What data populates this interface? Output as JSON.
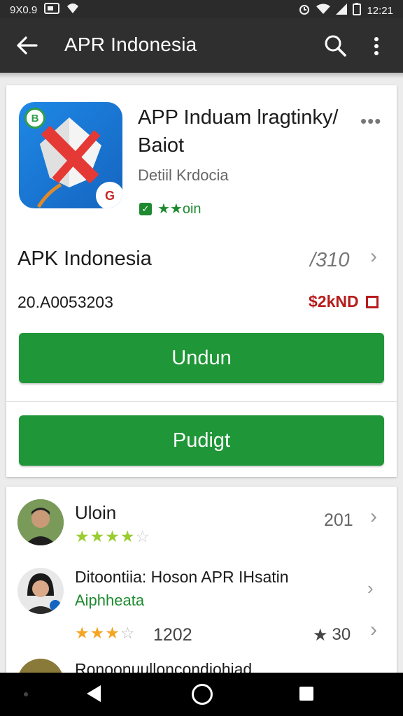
{
  "status_bar": {
    "time_left": "9X0.9",
    "time_right": "12:21"
  },
  "app_bar": {
    "title": "APR Indonesia"
  },
  "app_card": {
    "title": "APP Induam lragtinky/ Baiot",
    "developer": "Detiil Krdocia",
    "rating_label": "★★oin",
    "section_title": "APK Indonesia",
    "section_count": "/310",
    "code": "20.A0053203",
    "price": "$2kND",
    "primary_button": "Undun",
    "secondary_button": "Pudigt"
  },
  "reviews": [
    {
      "name": "Uloin",
      "count": "201",
      "stars": 3.5,
      "star_color": "#9acd32"
    },
    {
      "name": "Ditoontiia: Hoson APR IHsatin",
      "subtitle": "Aiphheata",
      "stars": 3.5,
      "star_color": "#f4a522",
      "count": "1202",
      "rating_value": "30"
    },
    {
      "name": "Ronoonuulloncondiohiad"
    }
  ],
  "colors": {
    "accent_green": "#1f9637",
    "price_red": "#b71c1c",
    "appbar": "#2f2f2f"
  }
}
